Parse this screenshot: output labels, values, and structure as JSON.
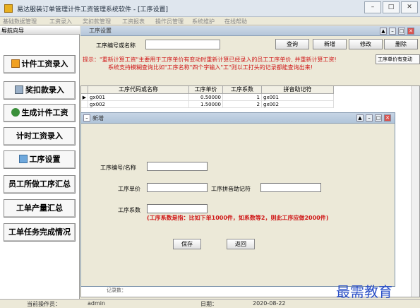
{
  "window": {
    "title": "易达服装订单管理计件工资管理系统软件 - [工序设置]"
  },
  "menu": [
    "基础数据管理",
    "工资录入",
    "奖扣款管理",
    "工资报表",
    "操作员管理",
    "系统维护",
    "在线帮助"
  ],
  "sidebar": {
    "header": "导航向导",
    "collapse": "«",
    "items": [
      {
        "label": "计件工资录入",
        "icon": "calculator-icon"
      },
      {
        "label": "奖扣款录入",
        "icon": "money-icon"
      },
      {
        "label": "生成计件工资",
        "icon": "generate-icon"
      },
      {
        "label": "计时工资录入",
        "icon": ""
      },
      {
        "label": "工序设置",
        "icon": "settings-icon"
      },
      {
        "label": "员工所做工序汇总",
        "icon": ""
      },
      {
        "label": "工单产量汇总",
        "icon": ""
      },
      {
        "label": "工单任务完成情况",
        "icon": ""
      }
    ]
  },
  "main": {
    "title": "工序设置",
    "search_label": "工序编号或名称",
    "search_value": "",
    "buttons": [
      "查询",
      "新增",
      "修改",
      "删除"
    ],
    "hint_line1": "提示：\"重新计算工资\"主要用于工序单价有变动时重新计算已经录入的员工工序单价, 并重新计算工资!",
    "hint_line2": "系统支持模糊查询比如\"工序名称\"四个字输入\"工\"则以工打头的记录都能查询出来!",
    "sort_button": "工序单价有变动",
    "grid": {
      "columns": [
        "工序代码或名称",
        "工序单价",
        "工序系数",
        "拼音助记符"
      ],
      "rows": [
        {
          "name": "gx001",
          "price": "0.50000",
          "factor": "1",
          "pinyin": "gx001"
        },
        {
          "name": "gx002",
          "price": "1.50000",
          "factor": "2",
          "pinyin": "gx002"
        }
      ]
    },
    "partial_footer": "记录数："
  },
  "dialog": {
    "title": "新增",
    "code_label": "工序编号/名称",
    "price_label": "工序单价",
    "pinyin_label": "工序拼音助记符",
    "factor_label": "工序系数",
    "hint": "(工序系数是指：比如下单1000件，如系数等2，则此工序应做2000件)",
    "save": "保存",
    "back": "返回"
  },
  "status": {
    "operator_label": "当前操作员：",
    "operator": "admin",
    "date_label": "日期：",
    "date": "2020-08-22"
  },
  "watermark": "最需教育",
  "colors": {
    "hint": "#d01818",
    "watermark": "#2a4fc7",
    "titlebar": "#b5c6d9"
  }
}
